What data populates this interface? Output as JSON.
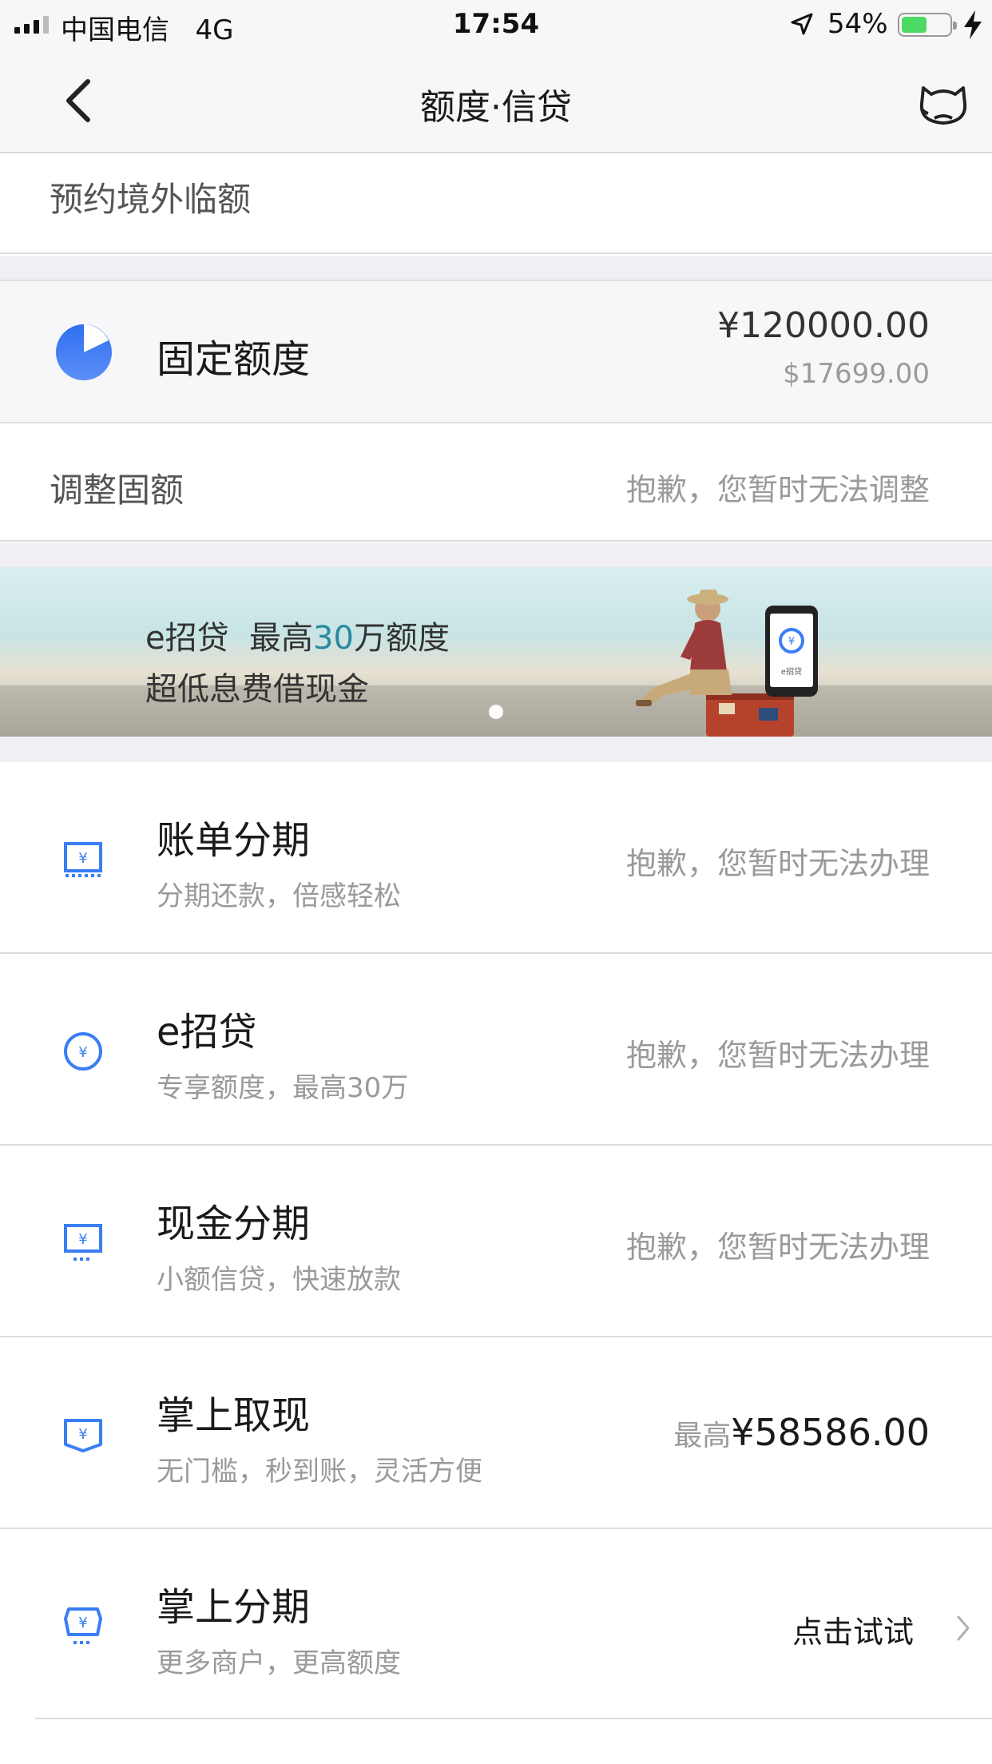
{
  "status_bar": {
    "carrier": "中国电信",
    "network": "4G",
    "time": "17:54",
    "battery_percent": "54%",
    "battery_level": 0.54,
    "battery_color": "#4cd964"
  },
  "nav": {
    "title": "额度·信贷",
    "back_icon": "chevron-left-icon",
    "mascot_icon": "cat-mascot-icon"
  },
  "prebook": {
    "label": "预约境外临额"
  },
  "fixed_limit": {
    "label": "固定额度",
    "cny_amount": "¥120000.00",
    "usd_amount": "$17699.00",
    "icon": "pie-chart-icon",
    "accent_color": "#3a7ef5"
  },
  "adjust": {
    "label": "调整固额",
    "status": "抱歉，您暂时无法调整"
  },
  "banner": {
    "line1_pre": "e招贷",
    "line1_mid": "最高",
    "line1_highlight": "30",
    "line1_post": "万额度",
    "line2": "超低息费借现金",
    "phone_label": "e招贷"
  },
  "products": [
    {
      "name": "账单分期",
      "sub": "分期还款，倍感轻松",
      "status": "抱歉，您暂时无法办理",
      "icon": "bill-installment-icon"
    },
    {
      "name": "e招贷",
      "sub": "专享额度，最高30万",
      "status": "抱歉，您暂时无法办理",
      "icon": "e-loan-icon"
    },
    {
      "name": "现金分期",
      "sub": "小额信贷，快速放款",
      "status": "抱歉，您暂时无法办理",
      "icon": "cash-installment-icon"
    },
    {
      "name": "掌上取现",
      "sub": "无门槛，秒到账，灵活方便",
      "amount_prefix": "最高",
      "amount": "¥58586.00",
      "icon": "cash-withdraw-icon"
    },
    {
      "name": "掌上分期",
      "sub": "更多商户，更高额度",
      "action": "点击试试",
      "icon": "mobile-installment-icon"
    }
  ],
  "colors": {
    "icon_blue": "#3a7ef5",
    "text_gray": "#9a9a9a",
    "banner_highlight": "#2a8aa0"
  }
}
